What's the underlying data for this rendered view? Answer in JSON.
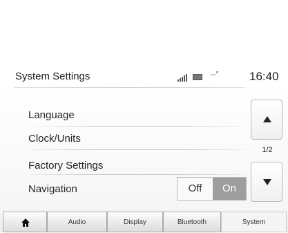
{
  "header": {
    "title": "System Settings",
    "temperature": "--°",
    "clock": "16:40"
  },
  "menu": {
    "items": [
      {
        "label": "Language"
      },
      {
        "label": "Clock/Units"
      },
      {
        "label": "Factory Settings"
      },
      {
        "label": "Navigation"
      }
    ]
  },
  "navigation_toggle": {
    "off_label": "Off",
    "on_label": "On",
    "selected": "On"
  },
  "pager": {
    "page_text": "1/2"
  },
  "tabs": [
    {
      "label": "",
      "icon": "home-icon"
    },
    {
      "label": "Audio"
    },
    {
      "label": "Display"
    },
    {
      "label": "Bluetooth"
    },
    {
      "label": "System",
      "active": true
    }
  ],
  "colors": {
    "toggle_active": "#9e9e9e",
    "text": "#222222"
  }
}
